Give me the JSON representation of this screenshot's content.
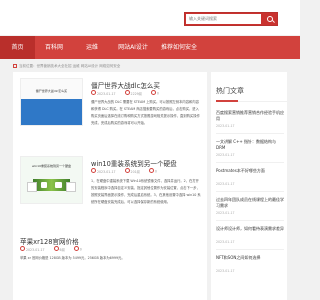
{
  "search": {
    "placeholder": "输入关键词搜索"
  },
  "nav": {
    "items": [
      {
        "label": "首页",
        "active": true
      },
      {
        "label": "百科网"
      },
      {
        "label": "运维"
      },
      {
        "label": "网站AI设计"
      },
      {
        "label": "推荐如何安全"
      }
    ]
  },
  "breadcrumb": {
    "text": "当前位置：世界营销技术大全社招 运维 网站AI设计 网络如何安全"
  },
  "articles": [
    {
      "title": "僵尸世界大战dlc怎么买",
      "date": "2023-01-17",
      "views": "2229阅",
      "comments": "0",
      "thumb_text": "僵尸世界大战dlc怎么买",
      "excerpt": "僵尸世界大战的 DLC 需要在 STEAM 上购买。可以按照左侧本内容和内容和获得 DLC 购买。在 STEAM 商店搜索要购买的游戏后，点击购买，进入购买页面后选择在线订购和购买方式按照游戏相关提示操作，直到购买操作完成，完成后购买的游戏将可以开始。"
    },
    {
      "title": "win10重装系统到另一个硬盘",
      "date": "2023-01-17",
      "views": "201阅",
      "comments": "0",
      "thumb_text": "win10重装系统到另一个硬盘",
      "excerpt": "1，在硬盘中重装系统下载 Win10系统镜像文件，选择并运行。2，在打开的安装程序中选择自定义安装，指定其他位置作为安装位置，点击下一步，按照安装界面提示操作，完成后重启系统。3，在其他设置中选择 win10 系统所在硬盘安装完成后，可以选择保存新的系统使用。"
    },
    {
      "title": "苹果xr128官网价格",
      "date": "2023-01-17",
      "views": "6阅",
      "comments": "0",
      "excerpt": "苹果 xr 官网价格是 128GB 版本为 5499元，256GB 版本为6999元。"
    }
  ],
  "sidebar": {
    "title": "热门文章",
    "items": [
      {
        "title": "百度搜索营销推荐营销合作经验手机应用",
        "date": "2023-01-17"
      },
      {
        "title": "一文讲解 C++ 指针：数据结构与 DRM",
        "date": "2023-01-17"
      },
      {
        "title": "Postmates本不好哪些方面",
        "date": "2023-01-17"
      },
      {
        "title": "过去四年团队成员在线课程上的最佳学习需求",
        "date": "2023-01-17"
      },
      {
        "title": "设计师设计师，如何看待表演需求差异",
        "date": "2023-01-17"
      },
      {
        "title": "NFT和SON之间如何选择",
        "date": "2023-01-17"
      }
    ]
  },
  "colors": {
    "accent": "#d2423d",
    "nav_active": "#b92f2b",
    "background": "#f1f1f1"
  }
}
